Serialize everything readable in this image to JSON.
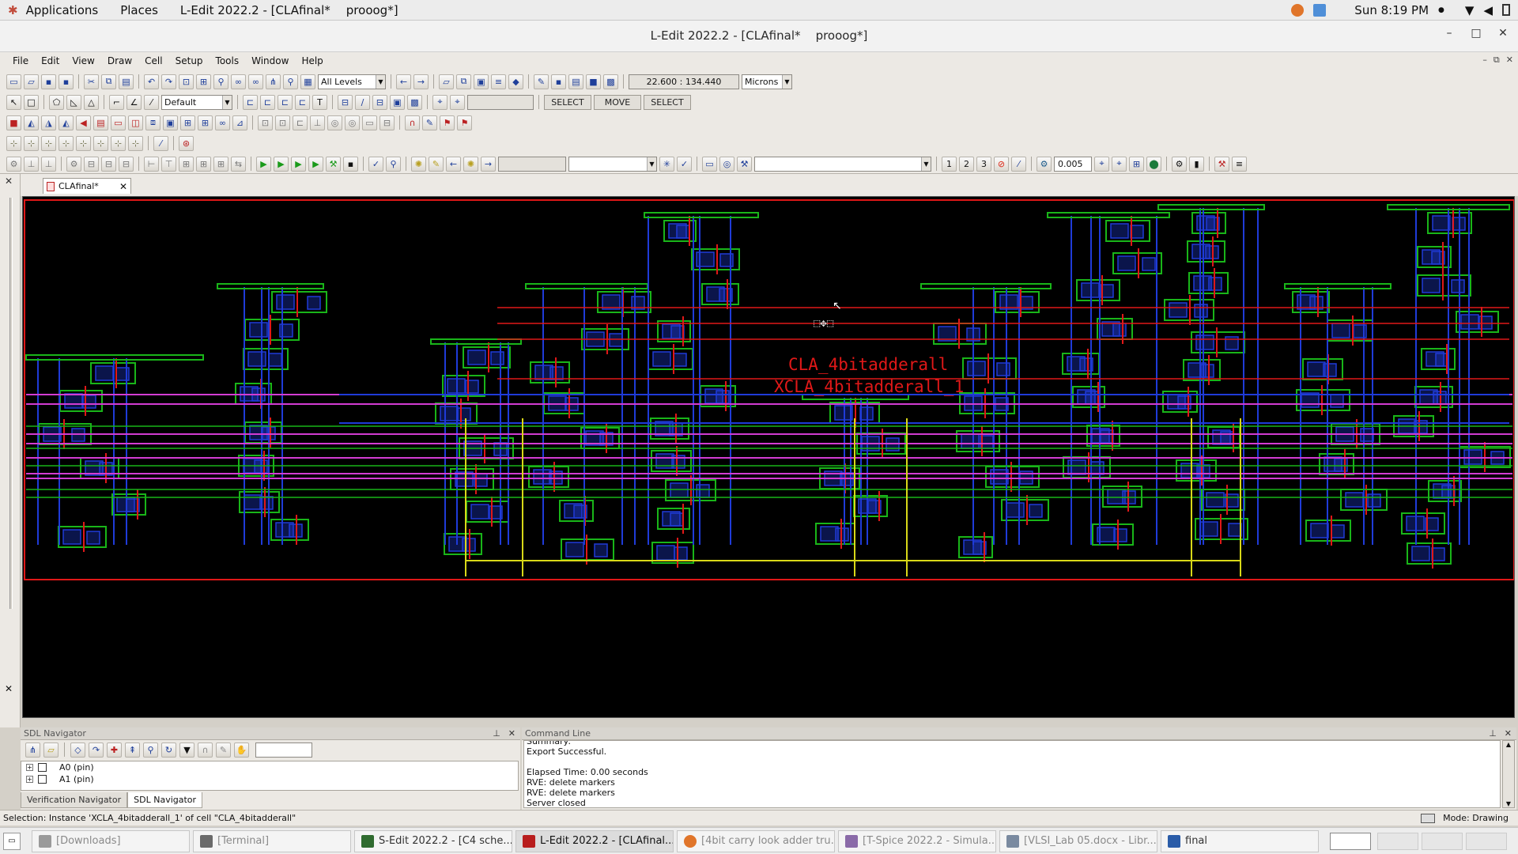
{
  "topbar": {
    "applications": "Applications",
    "places": "Places",
    "active_window": "L-Edit 2022.2 - [CLAfinal*",
    "active_window_2": "prooog*]",
    "clock": "Sun  8:19 PM"
  },
  "window": {
    "title": "L-Edit 2022.2 - [CLAfinal*",
    "title_2": "prooog*]"
  },
  "menu": [
    "File",
    "Edit",
    "View",
    "Draw",
    "Cell",
    "Setup",
    "Tools",
    "Window",
    "Help"
  ],
  "toolbar": {
    "levels": "All Levels",
    "coordinates": "22.600 : 134.440",
    "units": "Microns",
    "style": "Default",
    "mouse_left": "SELECT",
    "mouse_middle": "MOVE",
    "mouse_right": "SELECT",
    "snap_value": "0.005"
  },
  "doc_tab": "CLAfinal*",
  "canvas": {
    "cell_label": "CLA_4bitadderall",
    "instance_label": "XCLA_4bitadderall_1"
  },
  "sdl_navigator": {
    "title": "SDL Navigator",
    "items": [
      "A0 (pin)",
      "A1 (pin)"
    ],
    "tabs": [
      "Verification Navigator",
      "SDL Navigator"
    ]
  },
  "command_line": {
    "title": "Command Line",
    "lines": [
      "Summary:",
      "Export Successful.",
      "",
      "Elapsed Time: 0.00 seconds",
      "RVE: delete markers",
      "RVE: delete markers",
      "Server closed"
    ]
  },
  "status": {
    "selection": "Selection: Instance 'XCLA_4bitadderall_1' of cell \"CLA_4bitadderall\"",
    "mode": "Mode: Drawing"
  },
  "taskbar": [
    {
      "label": "[Downloads]",
      "color": "#9a9a9a",
      "state": "dim"
    },
    {
      "label": "[Terminal]",
      "color": "#6a6a6a",
      "state": "dim"
    },
    {
      "label": "S-Edit 2022.2 - [C4 sche...",
      "color": "#2f6b2f",
      "state": "normal"
    },
    {
      "label": "L-Edit 2022.2 - [CLAfinal...",
      "color": "#b81d1d",
      "state": "active"
    },
    {
      "label": "[4bit carry look adder tru...",
      "color": "#e0752a",
      "state": "dim"
    },
    {
      "label": "[T-Spice 2022.2 - Simula...",
      "color": "#8a6aa8",
      "state": "dim"
    },
    {
      "label": "[VLSI_Lab 05.docx - Libr...",
      "color": "#7a8aa0",
      "state": "dim"
    },
    {
      "label": "final",
      "color": "#2a5ca8",
      "state": "normal"
    }
  ],
  "colors": {
    "metal1": "#1f3bd8",
    "poly": "#e01818",
    "diffusion": "#19b519",
    "metal2": "#d23cd2",
    "metal3": "#d8d818",
    "canvas_bg": "#000000"
  }
}
